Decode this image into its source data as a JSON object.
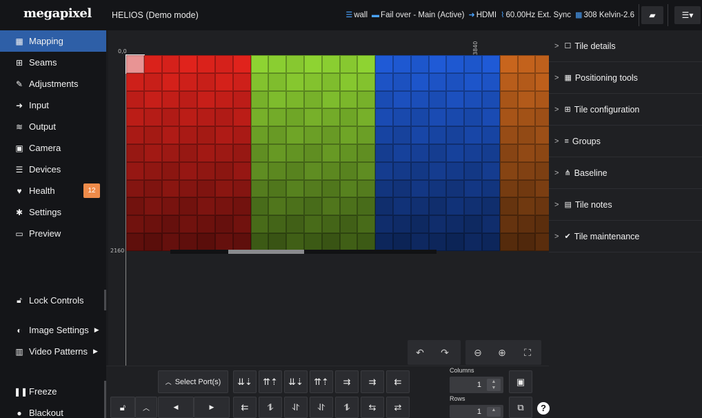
{
  "brand": {
    "logo": "megapixel"
  },
  "header": {
    "title": "HELIOS (Demo mode)",
    "status": [
      {
        "icon": "database-icon",
        "label": "wall"
      },
      {
        "icon": "server-icon",
        "label": "Fail over - Main (Active)"
      },
      {
        "icon": "input-icon",
        "label": "HDMI"
      },
      {
        "icon": "pulse-icon",
        "label": "60.00Hz Ext. Sync"
      },
      {
        "icon": "grid-icon",
        "label": "308 Kelvin-2.6"
      }
    ]
  },
  "sidebar": {
    "items": [
      {
        "label": "Mapping",
        "icon": "grid-icon",
        "glyph": "▦",
        "active": true
      },
      {
        "label": "Seams",
        "icon": "plus-square-icon",
        "glyph": "⊞"
      },
      {
        "label": "Adjustments",
        "icon": "brush-icon",
        "glyph": "✎"
      },
      {
        "label": "Input",
        "icon": "input-icon",
        "glyph": "➜"
      },
      {
        "label": "Output",
        "icon": "sliders-icon",
        "glyph": "≋"
      },
      {
        "label": "Camera",
        "icon": "film-icon",
        "glyph": "▣"
      },
      {
        "label": "Devices",
        "icon": "list-icon",
        "glyph": "☰"
      },
      {
        "label": "Health",
        "icon": "heart-pulse-icon",
        "glyph": "♥",
        "badge": "12"
      },
      {
        "label": "Settings",
        "icon": "gears-icon",
        "glyph": "✱"
      },
      {
        "label": "Preview",
        "icon": "monitor-icon",
        "glyph": "▭"
      }
    ],
    "lock_controls": "Lock Controls",
    "image_settings": "Image Settings",
    "video_patterns": "Video Patterns",
    "freeze": "Freeze",
    "blackout": "Blackout"
  },
  "canvas": {
    "origin_label": "0,0",
    "width_label": "3840",
    "height_label": "2160",
    "colors": {
      "red": "#e0231c",
      "green": "#8ed332",
      "blue": "#1f5ad6",
      "orange": "#c8651d"
    }
  },
  "panel": {
    "sections": [
      {
        "label": "Tile details",
        "icon": "square-icon",
        "glyph": "☐"
      },
      {
        "label": "Positioning tools",
        "icon": "grid-icon",
        "glyph": "▦"
      },
      {
        "label": "Tile configuration",
        "icon": "plus-square-icon",
        "glyph": "⊞"
      },
      {
        "label": "Groups",
        "icon": "layers-icon",
        "glyph": "≡"
      },
      {
        "label": "Baseline",
        "icon": "sitemap-icon",
        "glyph": "⋔"
      },
      {
        "label": "Tile notes",
        "icon": "file-icon",
        "glyph": "▤"
      },
      {
        "label": "Tile maintenance",
        "icon": "wrench-icon",
        "glyph": "✔"
      }
    ]
  },
  "toolbar": {
    "select_ports": "Select Port(s)",
    "columns_label": "Columns",
    "columns_value": "1",
    "rows_label": "Rows",
    "rows_value": "1",
    "help": "?"
  }
}
